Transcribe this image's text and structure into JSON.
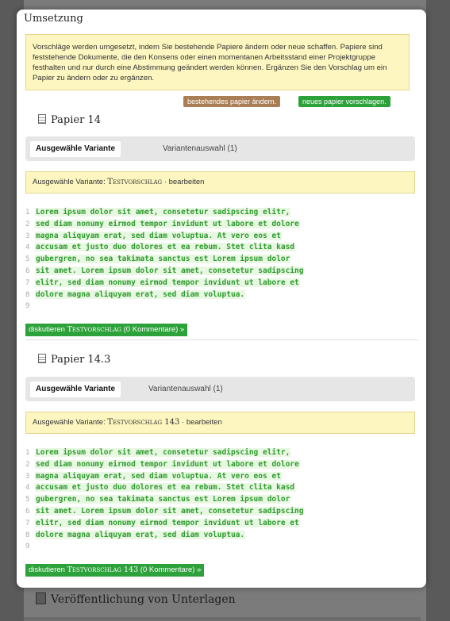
{
  "modal": {
    "title": "Umsetzung",
    "hint": "Vorschläge werden umgesetzt, indem Sie bestehende Papiere ändern oder neue schaffen. Papiere sind feststehende Dokumente, die den Konsens oder einen momentanen Arbeitsstand einer Projektgruppe festhalten und nur durch eine Abstimmung geändert werden können. Ergänzen Sie den Vorschlag um ein Papier zu ändern oder zu ergänzen.",
    "btn_change": "bestehendes papier ändern.",
    "btn_new": "neues papier vorschlagen."
  },
  "papers": [
    {
      "title": "Papier 14",
      "tab_active": "Ausgewähle Variante",
      "tab_other": "Variantenauswahl (1)",
      "selected_prefix": "Ausgewähle Variante:",
      "selected_name": "Testvorschlag",
      "edit_sep": "·",
      "edit": "bearbeiten",
      "discuss_prefix": "diskutieren",
      "discuss_name": "Testvorschlag",
      "discuss_suffix": "(0 Kommentare) »"
    },
    {
      "title": "Papier 14.3",
      "tab_active": "Ausgewähle Variante",
      "tab_other": "Variantenauswahl (1)",
      "selected_prefix": "Ausgewähle Variante:",
      "selected_name": "Testvorschlag 143",
      "edit_sep": "·",
      "edit": "bearbeiten",
      "discuss_prefix": "diskutieren",
      "discuss_name": "Testvorschlag 143",
      "discuss_suffix": "(0 Kommentare) »"
    }
  ],
  "code_lines": [
    {
      "n": "1",
      "t": "Lorem ipsum dolor sit amet, consetetur sadipscing elitr,"
    },
    {
      "n": "2",
      "t": "sed diam nonumy eirmod tempor invidunt ut labore et dolore"
    },
    {
      "n": "3",
      "t": "magna aliquyam erat, sed diam voluptua. At vero eos et"
    },
    {
      "n": "4",
      "t": "accusam et justo duo dolores et ea rebum. Stet clita kasd"
    },
    {
      "n": "5",
      "t": "gubergren, no sea takimata sanctus est Lorem ipsum dolor"
    },
    {
      "n": "6",
      "t": "sit amet. Lorem ipsum dolor sit amet, consetetur sadipscing"
    },
    {
      "n": "7",
      "t": "elitr, sed diam nonumy eirmod tempor invidunt ut labore et"
    },
    {
      "n": "8",
      "t": "dolore magna aliquyam erat, sed diam voluptua."
    },
    {
      "n": "9",
      "t": ""
    }
  ],
  "background": {
    "next_item": "Veröffentlichung von Unterlagen"
  },
  "colors": {
    "green": "#2da13a",
    "brown": "#a97e55",
    "hint_bg": "#fdf6c0"
  }
}
